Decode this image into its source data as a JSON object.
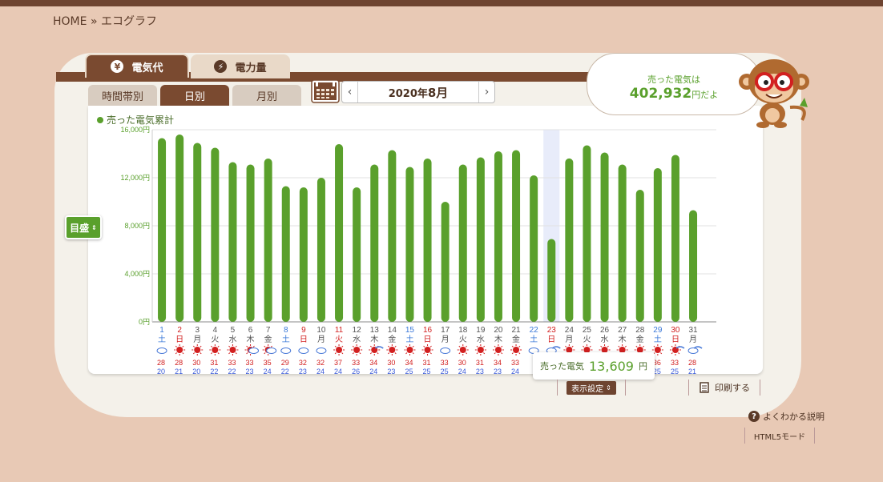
{
  "breadcrumb": {
    "home": "HOME",
    "sep": "»",
    "current": "エコグラフ"
  },
  "tabs": {
    "cost": "電気代",
    "power": "電力量"
  },
  "period_tabs": {
    "hourly": "時間帯別",
    "daily": "日別",
    "monthly": "月別"
  },
  "month_nav": {
    "year": "2020年",
    "month": "8月",
    "prev": "‹",
    "next": "›"
  },
  "bubble": {
    "label": "売った電気は",
    "value": "402,932",
    "suffix": "円だよ"
  },
  "scale_button": "目盛",
  "tooltip": {
    "label": "売った電気",
    "value": "13,609",
    "unit": "円"
  },
  "display_settings": "表示設定",
  "print_label": "印刷する",
  "help_label": "よくわかる説明",
  "html5_label": "HTML5モード",
  "colors": {
    "bar": "#5aa02c",
    "weekday": "#555555",
    "saturday": "#3a78d8",
    "sunday": "#d22020",
    "brown": "#7a4a30",
    "highlight": "#e8ecfa"
  },
  "icons": {
    "tab_cost": "yen-icon",
    "tab_power": "lightning-icon",
    "calendar": "calendar-icon",
    "print": "printer-icon",
    "help": "question-icon",
    "mascot": "monkey-mascot"
  },
  "chart_data": {
    "type": "bar",
    "title": "売った電気累計",
    "ylim": [
      0,
      16000
    ],
    "yticks": [
      "0円",
      "4,000円",
      "8,000円",
      "12,000円",
      "16,000円"
    ],
    "grid": true,
    "highlight_index": 22,
    "categories": [
      "1",
      "2",
      "3",
      "4",
      "5",
      "6",
      "7",
      "8",
      "9",
      "10",
      "11",
      "12",
      "13",
      "14",
      "15",
      "16",
      "17",
      "18",
      "19",
      "20",
      "21",
      "22",
      "23",
      "24",
      "25",
      "26",
      "27",
      "28",
      "29",
      "30",
      "31"
    ],
    "weekdays": [
      "土",
      "日",
      "月",
      "火",
      "水",
      "木",
      "金",
      "土",
      "日",
      "月",
      "火",
      "水",
      "木",
      "金",
      "土",
      "日",
      "月",
      "火",
      "水",
      "木",
      "金",
      "土",
      "日",
      "月",
      "火",
      "水",
      "木",
      "金",
      "土",
      "日",
      "月"
    ],
    "day_kind": [
      "sat",
      "sun",
      "wd",
      "wd",
      "wd",
      "wd",
      "wd",
      "sat",
      "sun",
      "wd",
      "sun",
      "wd",
      "wd",
      "wd",
      "sat",
      "sun",
      "wd",
      "wd",
      "wd",
      "wd",
      "wd",
      "sat",
      "sun",
      "wd",
      "wd",
      "wd",
      "wd",
      "wd",
      "sat",
      "sun",
      "wd"
    ],
    "values": [
      15300,
      15600,
      14900,
      14500,
      13300,
      13100,
      13600,
      11300,
      11200,
      12000,
      14800,
      11200,
      13100,
      14300,
      12900,
      13600,
      10000,
      13100,
      13700,
      14200,
      14300,
      12200,
      6900,
      13609,
      14700,
      14100,
      13100,
      11000,
      12800,
      13900,
      9300
    ],
    "weather": [
      "cloud-sun",
      "sun",
      "sun",
      "sun",
      "sun",
      "sun-cloud",
      "sun-cloud",
      "cloud-sun",
      "cloud-sun",
      "cloud-sun",
      "sun",
      "sun",
      "sun-rain",
      "sun",
      "sun",
      "sun",
      "cloud-sun",
      "sun",
      "sun",
      "sun",
      "sun",
      "cloud-sun",
      "cloud-rain",
      "sun",
      "sun",
      "sun",
      "sun",
      "sun",
      "sun",
      "sun-rain",
      "cloud-rain"
    ],
    "temp_high": [
      "28",
      "28",
      "30",
      "31",
      "33",
      "33",
      "35",
      "29",
      "32",
      "32",
      "37",
      "33",
      "34",
      "30",
      "34",
      "31",
      "33",
      "30",
      "31",
      "34",
      "33",
      "",
      "",
      "",
      "",
      "",
      "",
      "",
      "36",
      "33",
      "28"
    ],
    "temp_low": [
      "20",
      "21",
      "20",
      "22",
      "22",
      "23",
      "24",
      "22",
      "23",
      "24",
      "24",
      "26",
      "24",
      "23",
      "25",
      "25",
      "25",
      "24",
      "23",
      "23",
      "24",
      "",
      "",
      "",
      "",
      "",
      "",
      "",
      "25",
      "25",
      "21"
    ]
  }
}
